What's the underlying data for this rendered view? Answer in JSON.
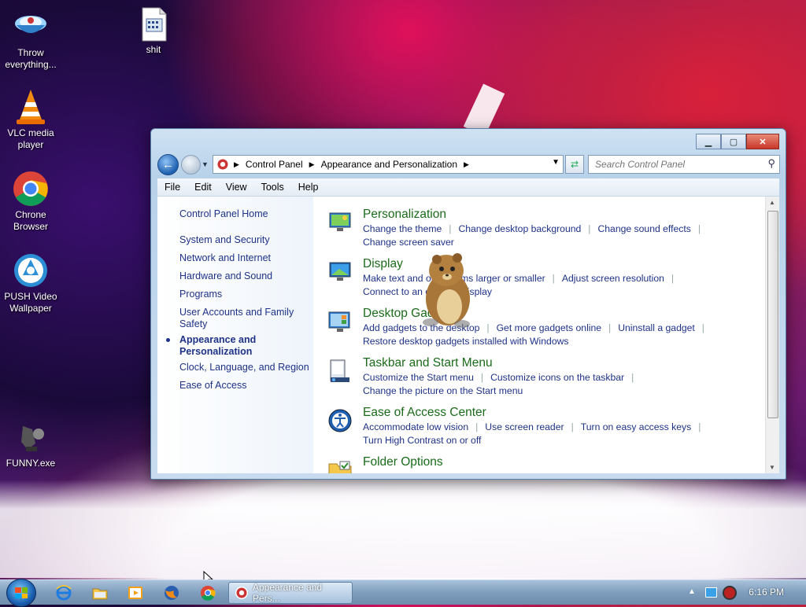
{
  "desktop": {
    "icons": [
      {
        "label": "Throw everything...",
        "icon": "bowl-icon"
      },
      {
        "label": "shit",
        "icon": "document-icon"
      },
      {
        "label": "VLC media player",
        "icon": "vlc-cone-icon"
      },
      {
        "label": "Chrone Browser",
        "icon": "chrome-icon"
      },
      {
        "label": "PUSH Video Wallpaper",
        "icon": "push-icon"
      },
      {
        "label": "FUNNY.exe",
        "icon": "executable-icon"
      }
    ]
  },
  "window": {
    "title": "",
    "controls": {
      "minimize": "▁",
      "maximize": "▢",
      "close": "✕"
    },
    "address": {
      "crumbs": [
        "Control Panel",
        "Appearance and Personalization"
      ]
    },
    "search": {
      "placeholder": "Search Control Panel"
    },
    "menu": [
      "File",
      "Edit",
      "View",
      "Tools",
      "Help"
    ],
    "sidebar": {
      "items": [
        {
          "label": "Control Panel Home",
          "active": false
        },
        {
          "label": "System and Security",
          "active": false
        },
        {
          "label": "Network and Internet",
          "active": false
        },
        {
          "label": "Hardware and Sound",
          "active": false
        },
        {
          "label": "Programs",
          "active": false
        },
        {
          "label": "User Accounts and Family Safety",
          "active": false
        },
        {
          "label": "Appearance and Personalization",
          "active": true
        },
        {
          "label": "Clock, Language, and Region",
          "active": false
        },
        {
          "label": "Ease of Access",
          "active": false
        }
      ]
    },
    "categories": [
      {
        "title": "Personalization",
        "icon": "personalization-monitor-icon",
        "links": [
          "Change the theme",
          "Change desktop background",
          "Change sound effects",
          "Change screen saver"
        ]
      },
      {
        "title": "Display",
        "icon": "display-monitor-icon",
        "links": [
          "Make text and other items larger or smaller",
          "Adjust screen resolution",
          "Connect to an external display"
        ]
      },
      {
        "title": "Desktop Gadgets",
        "icon": "gadgets-icon",
        "links": [
          "Add gadgets to the desktop",
          "Get more gadgets online",
          "Uninstall a gadget",
          "Restore desktop gadgets installed with Windows"
        ]
      },
      {
        "title": "Taskbar and Start Menu",
        "icon": "taskbar-icon",
        "links": [
          "Customize the Start menu",
          "Customize icons on the taskbar",
          "Change the picture on the Start menu"
        ]
      },
      {
        "title": "Ease of Access Center",
        "icon": "ease-of-access-icon",
        "links": [
          "Accommodate low vision",
          "Use screen reader",
          "Turn on easy access keys",
          "Turn High Contrast on or off"
        ]
      },
      {
        "title": "Folder Options",
        "icon": "folder-options-icon",
        "links": []
      }
    ]
  },
  "taskbar": {
    "pinned": [
      "ie-icon",
      "explorer-folder-icon",
      "media-player-icon",
      "firefox-icon",
      "chrome-icon"
    ],
    "active_task": "Appearance and Pers...",
    "clock": "6:16 PM",
    "tray_icons": [
      "show-hidden-icons-icon",
      "action-center-icon",
      "volume-icon"
    ]
  },
  "colors": {
    "link": "#1e3287",
    "category_title": "#1a6b1a",
    "taskbar": "#7e9dbd"
  }
}
